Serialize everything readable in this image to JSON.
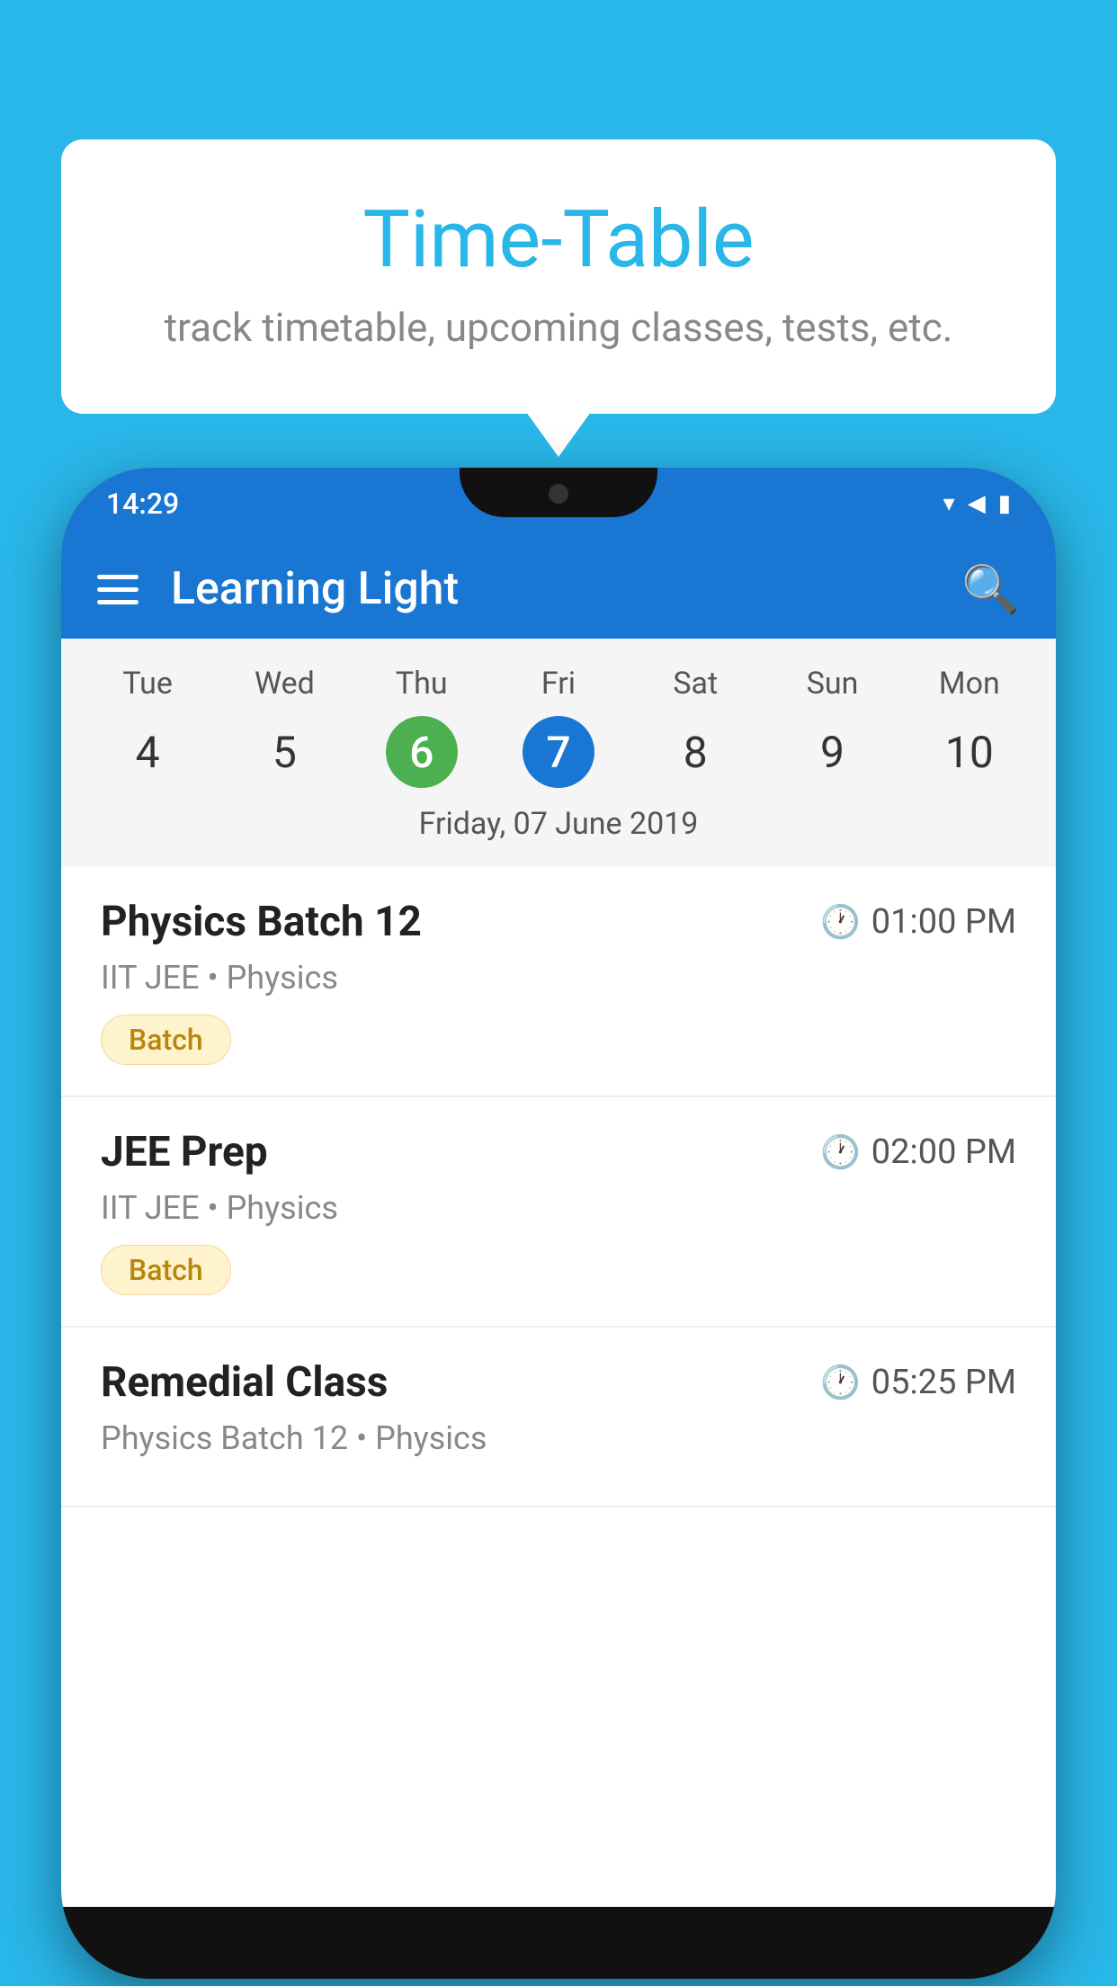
{
  "background_color": "#29B6E8",
  "tooltip": {
    "title": "Time-Table",
    "subtitle": "track timetable, upcoming classes, tests, etc."
  },
  "phone": {
    "status_bar": {
      "time": "14:29",
      "wifi": "wifi",
      "signal": "signal",
      "battery": "battery"
    },
    "app_bar": {
      "title": "Learning Light",
      "menu_icon": "hamburger",
      "search_icon": "search"
    },
    "calendar": {
      "days": [
        {
          "name": "Tue",
          "number": "4",
          "state": "normal"
        },
        {
          "name": "Wed",
          "number": "5",
          "state": "normal"
        },
        {
          "name": "Thu",
          "number": "6",
          "state": "today"
        },
        {
          "name": "Fri",
          "number": "7",
          "state": "selected"
        },
        {
          "name": "Sat",
          "number": "8",
          "state": "normal"
        },
        {
          "name": "Sun",
          "number": "9",
          "state": "normal"
        },
        {
          "name": "Mon",
          "number": "10",
          "state": "normal"
        }
      ],
      "selected_date_label": "Friday, 07 June 2019"
    },
    "schedule_items": [
      {
        "title": "Physics Batch 12",
        "time": "01:00 PM",
        "subtitle": "IIT JEE • Physics",
        "tag": "Batch"
      },
      {
        "title": "JEE Prep",
        "time": "02:00 PM",
        "subtitle": "IIT JEE • Physics",
        "tag": "Batch"
      },
      {
        "title": "Remedial Class",
        "time": "05:25 PM",
        "subtitle": "Physics Batch 12 • Physics",
        "tag": null
      }
    ]
  }
}
